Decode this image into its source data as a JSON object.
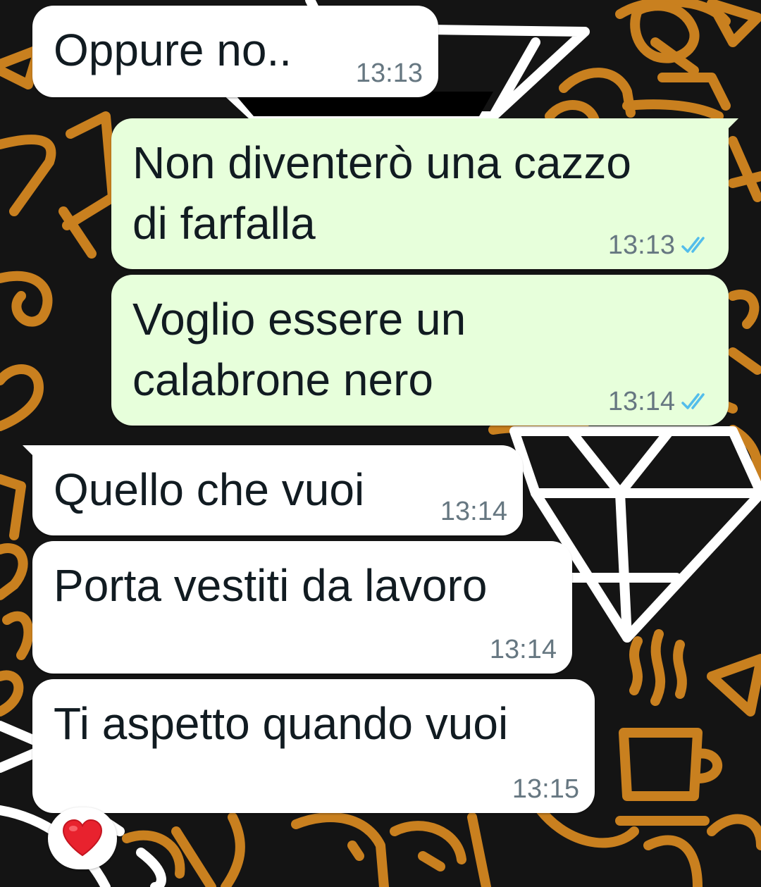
{
  "colors": {
    "incoming_bubble": "#ffffff",
    "outgoing_bubble": "#e7ffdb",
    "message_text": "#111b21",
    "timestamp": "#667781",
    "read_ticks": "#53bdeb",
    "wallpaper_orange": "#c9801f",
    "wallpaper_white": "#ffffff",
    "wallpaper_bg": "#141414"
  },
  "messages": [
    {
      "direction": "incoming",
      "lines": [
        "Oppure no.."
      ],
      "time": "13:13"
    },
    {
      "direction": "outgoing",
      "lines": [
        "Non diventerò una cazzo",
        "di farfalla"
      ],
      "time": "13:13",
      "status": "read-double-check-icon"
    },
    {
      "direction": "outgoing",
      "lines": [
        "Voglio essere un",
        "calabrone nero"
      ],
      "time": "13:14",
      "status": "read-double-check-icon"
    },
    {
      "direction": "incoming",
      "lines": [
        "Quello che vuoi"
      ],
      "time": "13:14"
    },
    {
      "direction": "incoming",
      "lines": [
        "Porta vestiti da lavoro"
      ],
      "time": "13:14"
    },
    {
      "direction": "incoming",
      "lines": [
        "Ti aspetto quando vuoi"
      ],
      "time": "13:15"
    }
  ],
  "reaction": {
    "icon": "red-heart-icon",
    "emoji": "❤️"
  }
}
